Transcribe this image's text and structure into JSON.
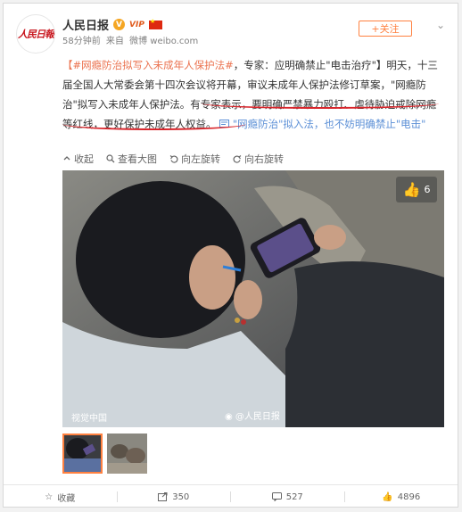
{
  "account": {
    "name": "人民日报",
    "avatar_text": "人民日報",
    "vip_badge": "VIP",
    "time": "58分钟前",
    "source_prefix": "来自",
    "source": "微博 weibo.com",
    "follow_label": "+关注"
  },
  "post": {
    "hashtag": "【#网瘾防治拟写入未成年人保护法#",
    "line1_rest": "，专家：应明确禁止\"电击治疗\"】明天，十三届全国人大常委会第十四次会议将开幕，审议未成年人保护法修订草案，\"网瘾防治\"拟写入未成年人保护法。",
    "highlight": "有专家表示，要明确严禁暴力殴打、虐待胁迫戒除网瘾等红线，更好保护未成年人权益。",
    "link_text": "\"网瘾防治\"拟入法，也不妨明确禁止\"电击\""
  },
  "toolbar": {
    "collapse": "收起",
    "view_large": "查看大图",
    "rotate_left": "向左旋转",
    "rotate_right": "向右旋转"
  },
  "media": {
    "like_count": "6",
    "credit": "视觉中国",
    "watermark": "@人民日报"
  },
  "actions": {
    "favorite": "收藏",
    "repost_count": "350",
    "comment_count": "527",
    "like_count": "4896"
  },
  "colors": {
    "accent_orange": "#ff8140",
    "link_orange": "#eb7350",
    "underline_red": "#d9262c"
  }
}
